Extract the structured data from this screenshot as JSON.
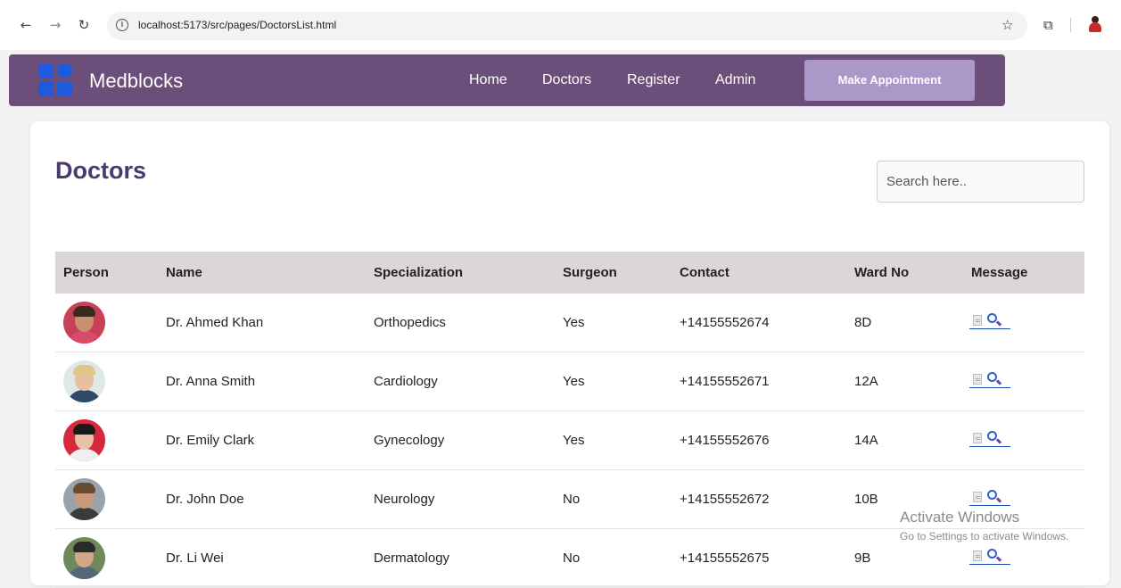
{
  "browser": {
    "url": "localhost:5173/src/pages/DoctorsList.html",
    "back_icon": "arrow-left",
    "forward_icon": "arrow-right",
    "reload_icon": "reload",
    "info_icon": "info",
    "star_icon": "star",
    "extensions_icon": "puzzle"
  },
  "navbar": {
    "brand": "Medblocks",
    "links": [
      "Home",
      "Doctors",
      "Register",
      "Admin"
    ],
    "cta": "Make Appointment",
    "colors": {
      "bar": "#6b4f7a",
      "cta": "#ab98c9",
      "logo": "#1e5bdc"
    }
  },
  "page": {
    "title": "Doctors",
    "search_placeholder": "Search here.."
  },
  "table": {
    "headers": [
      "Person",
      "Name",
      "Specialization",
      "Surgeon",
      "Contact",
      "Ward No",
      "Message"
    ],
    "rows": [
      {
        "name": "Dr. Ahmed Khan",
        "specialization": "Orthopedics",
        "surgeon": "Yes",
        "contact": "+14155552674",
        "ward": "8D"
      },
      {
        "name": "Dr. Anna Smith",
        "specialization": "Cardiology",
        "surgeon": "Yes",
        "contact": "+14155552671",
        "ward": "12A"
      },
      {
        "name": "Dr. Emily Clark",
        "specialization": "Gynecology",
        "surgeon": "Yes",
        "contact": "+14155552676",
        "ward": "14A"
      },
      {
        "name": "Dr. John Doe",
        "specialization": "Neurology",
        "surgeon": "No",
        "contact": "+14155552672",
        "ward": "10B"
      },
      {
        "name": "Dr. Li Wei",
        "specialization": "Dermatology",
        "surgeon": "No",
        "contact": "+14155552675",
        "ward": "9B"
      }
    ]
  },
  "watermark": {
    "line1": "Activate Windows",
    "line2": "Go to Settings to activate Windows."
  }
}
